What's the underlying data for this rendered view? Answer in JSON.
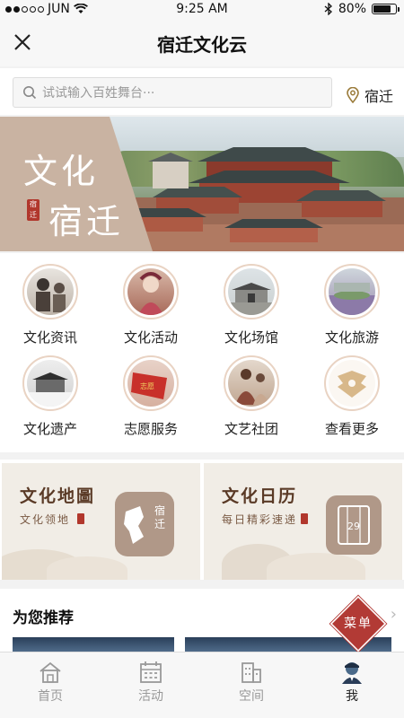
{
  "status_bar": {
    "carrier": "JUN",
    "time": "9:25 AM",
    "battery": "80%",
    "battery_level": 0.8
  },
  "nav": {
    "title": "宿迁文化云",
    "close_icon": "close-icon"
  },
  "search": {
    "placeholder": "试试输入百姓舞台···",
    "location": "宿迁"
  },
  "banner": {
    "line1": "文化",
    "line2": "宿迁",
    "seal": "宿迁"
  },
  "categories": [
    {
      "label": "文化资讯",
      "icon": "news-photo-icon"
    },
    {
      "label": "文化活动",
      "icon": "opera-photo-icon"
    },
    {
      "label": "文化场馆",
      "icon": "venue-photo-icon"
    },
    {
      "label": "文化旅游",
      "icon": "travel-photo-icon"
    },
    {
      "label": "文化遗产",
      "icon": "heritage-photo-icon"
    },
    {
      "label": "志愿服务",
      "icon": "volunteer-flag-icon"
    },
    {
      "label": "文艺社团",
      "icon": "troupe-photo-icon"
    },
    {
      "label": "查看更多",
      "icon": "more-emblem-icon"
    }
  ],
  "cards": [
    {
      "title": "文化地圖",
      "subtitle": "文化领地",
      "badge": "宿迁"
    },
    {
      "title": "文化日历",
      "subtitle": "每日精彩速递",
      "badge": "29"
    }
  ],
  "recommend": {
    "title": "为您推荐"
  },
  "menu_button": {
    "label": "菜单"
  },
  "tabs": [
    {
      "label": "首页",
      "icon": "home-icon",
      "active": false
    },
    {
      "label": "活动",
      "icon": "calendar-icon",
      "active": false
    },
    {
      "label": "空间",
      "icon": "building-icon",
      "active": false
    },
    {
      "label": "我",
      "icon": "user-icon",
      "active": true
    }
  ]
}
